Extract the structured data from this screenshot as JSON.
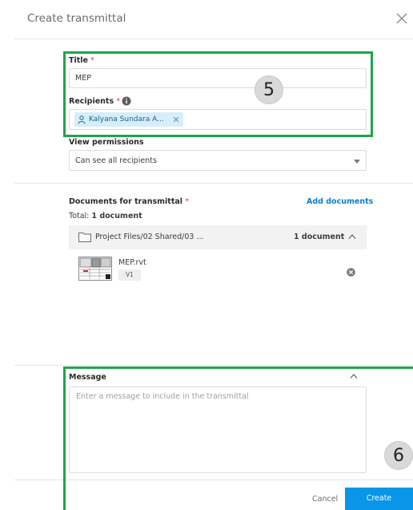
{
  "dialog": {
    "title": "Create transmittal"
  },
  "form": {
    "title_label": "Title",
    "title_required": "*",
    "title_value": "MEP",
    "recipients_label": "Recipients",
    "recipients_required": "*",
    "recipient_chip": "Kalyana Sundara A...",
    "view_permissions_label": "View permissions",
    "view_permissions_value": "Can see all recipients"
  },
  "documents": {
    "label": "Documents for transmittal",
    "required": "*",
    "add_link": "Add documents",
    "total_label": "Total:",
    "total_value": "1 document",
    "folder_path": "Project Files/02 Shared/03 ...",
    "folder_count": "1 document",
    "file_name": "MEP.rvt",
    "file_version": "V1"
  },
  "message": {
    "label": "Message",
    "placeholder": "Enter a message to include in the transmittal"
  },
  "footer": {
    "cancel_label": "Cancel",
    "create_label": "Create"
  },
  "annotations": {
    "step_a": "5",
    "step_b": "6"
  },
  "colors": {
    "accent": "#0a96e8",
    "highlight": "#1fa64a",
    "required": "#e2372f",
    "chip_bg": "#d6eef9"
  }
}
